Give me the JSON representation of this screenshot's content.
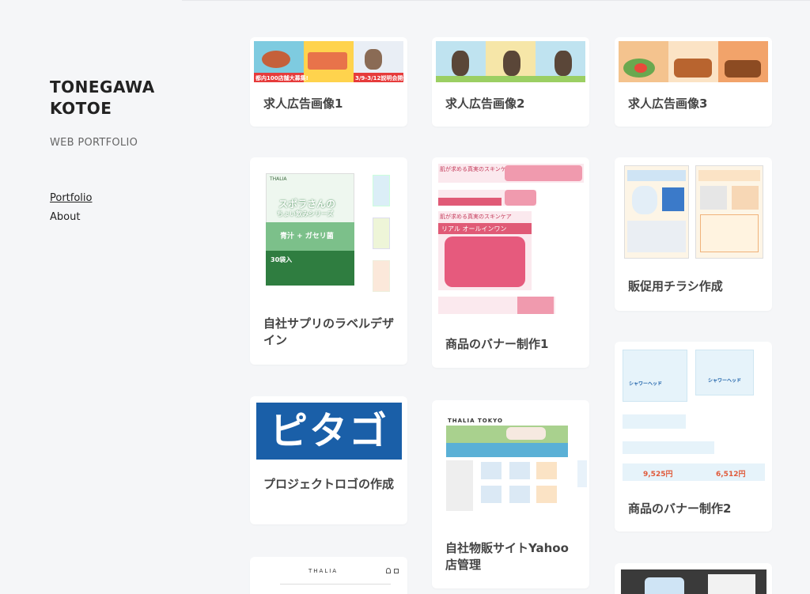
{
  "sidebar": {
    "name_line1": "TONEGAWA",
    "name_line2": "KOTOE",
    "subtitle": "WEB PORTFOLIO",
    "nav": [
      {
        "label": "Portfolio",
        "active": true
      },
      {
        "label": "About",
        "active": false
      }
    ]
  },
  "cards": {
    "job1": {
      "caption": "求人広告画像1"
    },
    "job2": {
      "caption": "求人広告画像2"
    },
    "job3": {
      "caption": "求人広告画像3"
    },
    "label": {
      "caption": "自社サプリのラベルデザイン"
    },
    "banner1": {
      "caption": "商品のバナー制作1"
    },
    "flyer": {
      "caption": "販促用チラシ作成"
    },
    "logo": {
      "caption": "プロジェクトロゴの作成"
    },
    "yahoo": {
      "caption": "自社物販サイトYahoo店管理"
    },
    "banner2": {
      "caption": "商品のバナー制作2"
    }
  },
  "thumb_text": {
    "job1_ribbon": "都内100店舗大募集!",
    "job1_dates": "3/9-3/12説明会開催",
    "label_brand": "THALIA",
    "label_title": "スポラさんの",
    "label_series": "ちょい飲みシリーズ",
    "label_product": "青汁 + ガセリ菌",
    "label_count": "30袋入",
    "banner_head": "肌が求める真実のスキンケア",
    "banner_sub": "リアル オールインワン",
    "logo_text": "ピタゴル",
    "yahoo_brand": "THALIA TOKYO",
    "shower_name": "シャワーヘッド",
    "price1": "9,525円",
    "price2": "6,512円",
    "thumb_brand": "THALIA"
  },
  "colors": {
    "background": "#f5f6f8",
    "card": "#ffffff",
    "logo_blue": "#1a5fa8",
    "banner_pink": "#e05a76",
    "label_green": "#7cc08a"
  }
}
